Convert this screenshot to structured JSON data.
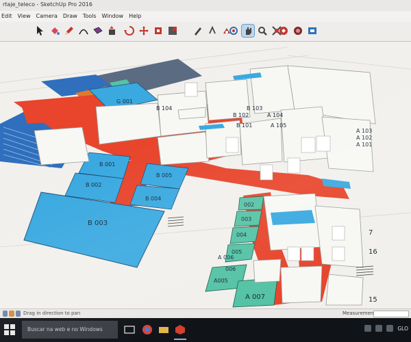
{
  "window": {
    "title": "rtaje_teleco - SketchUp Pro 2016"
  },
  "menu": [
    "Edit",
    "View",
    "Camera",
    "Draw",
    "Tools",
    "Window",
    "Help"
  ],
  "toolbar": {
    "tools": [
      "select-icon",
      "paint-bucket-icon",
      "pencil-icon",
      "arc-icon",
      "rectangle-icon",
      "push-pull-icon",
      "rotate-icon",
      "move-icon",
      "offset-icon",
      "scale-icon",
      "tape-measure-icon",
      "text-icon",
      "paint-icon",
      "orbit-icon",
      "pan-icon",
      "zoom-icon",
      "zoom-extents-icon",
      "warehouse-icon",
      "extension-icon",
      "layout-icon"
    ],
    "active_tool": "pan-icon"
  },
  "model": {
    "room_labels": {
      "b001": "B 001",
      "b002": "B 002",
      "b003": "B 003",
      "b004": "B 004",
      "b005": "B 005",
      "b101": "B 101",
      "b102": "B 102",
      "b103": "B 103",
      "b104": "B 104",
      "a101": "A 101",
      "a102": "A 102",
      "a103": "A 103",
      "a104": "A 104",
      "a105": "A 105",
      "a007": "A 007",
      "a005": "A005",
      "a006": "A 006",
      "g001": "G 001",
      "r002": "002",
      "r003": "003",
      "r004": "004",
      "r005": "005",
      "r006": "006",
      "r007": "7",
      "r016": "16",
      "r015": "15"
    },
    "colors": {
      "corridor": "#e8452c",
      "room_blue": "#3aa9e0",
      "room_teal": "#55c3a5",
      "room_gray": "#e8e8e2",
      "wall": "#f7f7f4",
      "auditorium": "#2f6fbd",
      "slate": "#5b6b82",
      "orange": "#e07a2c"
    }
  },
  "status": {
    "hint": "Drag in direction to pan",
    "measurements_label": "Measurements",
    "measurements_value": ""
  },
  "taskbar": {
    "search_placeholder": "Buscar na web e no Windows",
    "tray_text": "GLO"
  }
}
